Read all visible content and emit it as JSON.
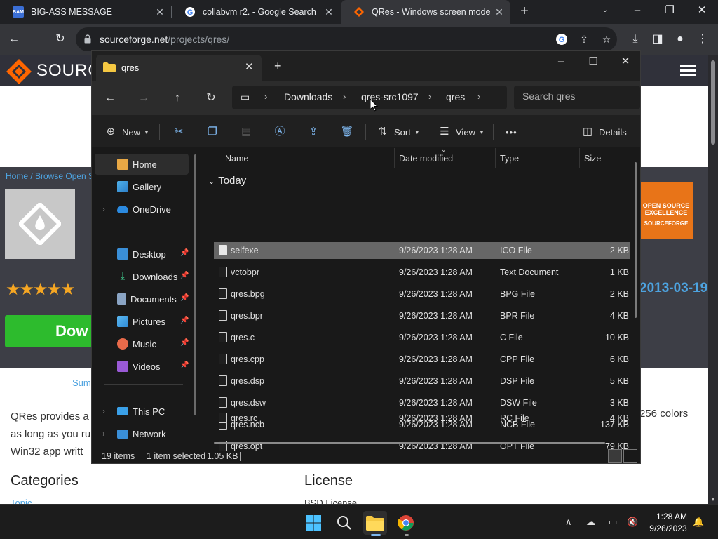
{
  "browser": {
    "tabs": [
      {
        "title": "BIG-ASS MESSAGE",
        "favicon": "BAM"
      },
      {
        "title": "collabvm r2. - Google Search",
        "favicon": "G"
      },
      {
        "title": "QRes - Windows screen mode ch",
        "favicon": "sf"
      }
    ],
    "url_host": "sourceforge.net",
    "url_path": "/projects/qres/"
  },
  "sourceforge": {
    "logo_text": "SOURC",
    "breadcrumb": "Home / Browse Open S",
    "download_label": "Dow",
    "badge_text": "OPEN SOURCE EXCELLENCE",
    "badge_brand": "SOURCEFORGE",
    "date": "2013-03-19",
    "summary_tab": "Sum",
    "description_lines": [
      "QRes provides a",
      "as long as you ru",
      "Win32 app writt"
    ],
    "description_right": "256 colors",
    "categories_heading": "Categories",
    "license_heading": "License",
    "topic_link": "Topic",
    "license_value": "BSD License"
  },
  "explorer": {
    "tab_title": "qres",
    "breadcrumb": [
      "Downloads",
      "qres-src1097",
      "qres"
    ],
    "search_placeholder": "Search qres",
    "commands": {
      "new": "New",
      "sort": "Sort",
      "view": "View",
      "more": "•••",
      "details": "Details"
    },
    "nav": {
      "home": "Home",
      "gallery": "Gallery",
      "onedrive": "OneDrive",
      "desktop": "Desktop",
      "downloads": "Downloads",
      "documents": "Documents",
      "pictures": "Pictures",
      "music": "Music",
      "videos": "Videos",
      "thispc": "This PC",
      "network": "Network"
    },
    "columns": {
      "name": "Name",
      "date": "Date modified",
      "type": "Type",
      "size": "Size"
    },
    "group": "Today",
    "files": [
      {
        "name": "selfexe",
        "date": "9/26/2023 1:28 AM",
        "type": "ICO File",
        "size": "2 KB"
      },
      {
        "name": "vctobpr",
        "date": "9/26/2023 1:28 AM",
        "type": "Text Document",
        "size": "1 KB"
      },
      {
        "name": "qres.bpg",
        "date": "9/26/2023 1:28 AM",
        "type": "BPG File",
        "size": "2 KB"
      },
      {
        "name": "qres.bpr",
        "date": "9/26/2023 1:28 AM",
        "type": "BPR File",
        "size": "4 KB"
      },
      {
        "name": "qres.c",
        "date": "9/26/2023 1:28 AM",
        "type": "C File",
        "size": "10 KB"
      },
      {
        "name": "qres.cpp",
        "date": "9/26/2023 1:28 AM",
        "type": "CPP File",
        "size": "6 KB"
      },
      {
        "name": "qres.dsp",
        "date": "9/26/2023 1:28 AM",
        "type": "DSP File",
        "size": "5 KB"
      },
      {
        "name": "qres.dsw",
        "date": "9/26/2023 1:28 AM",
        "type": "DSW File",
        "size": "3 KB"
      },
      {
        "name": "qres.ncb",
        "date": "9/26/2023 1:28 AM",
        "type": "NCB File",
        "size": "137 KB"
      },
      {
        "name": "qres.opt",
        "date": "9/26/2023 1:28 AM",
        "type": "OPT File",
        "size": "79 KB"
      },
      {
        "name": "qres.rc",
        "date": "9/26/2023 1:28 AM",
        "type": "RC File",
        "size": "4 KB"
      }
    ],
    "status": {
      "count": "19 items",
      "selected": "1 item selected",
      "size": "1.05 KB"
    }
  },
  "taskbar": {
    "time": "1:28 AM",
    "date": "9/26/2023"
  }
}
